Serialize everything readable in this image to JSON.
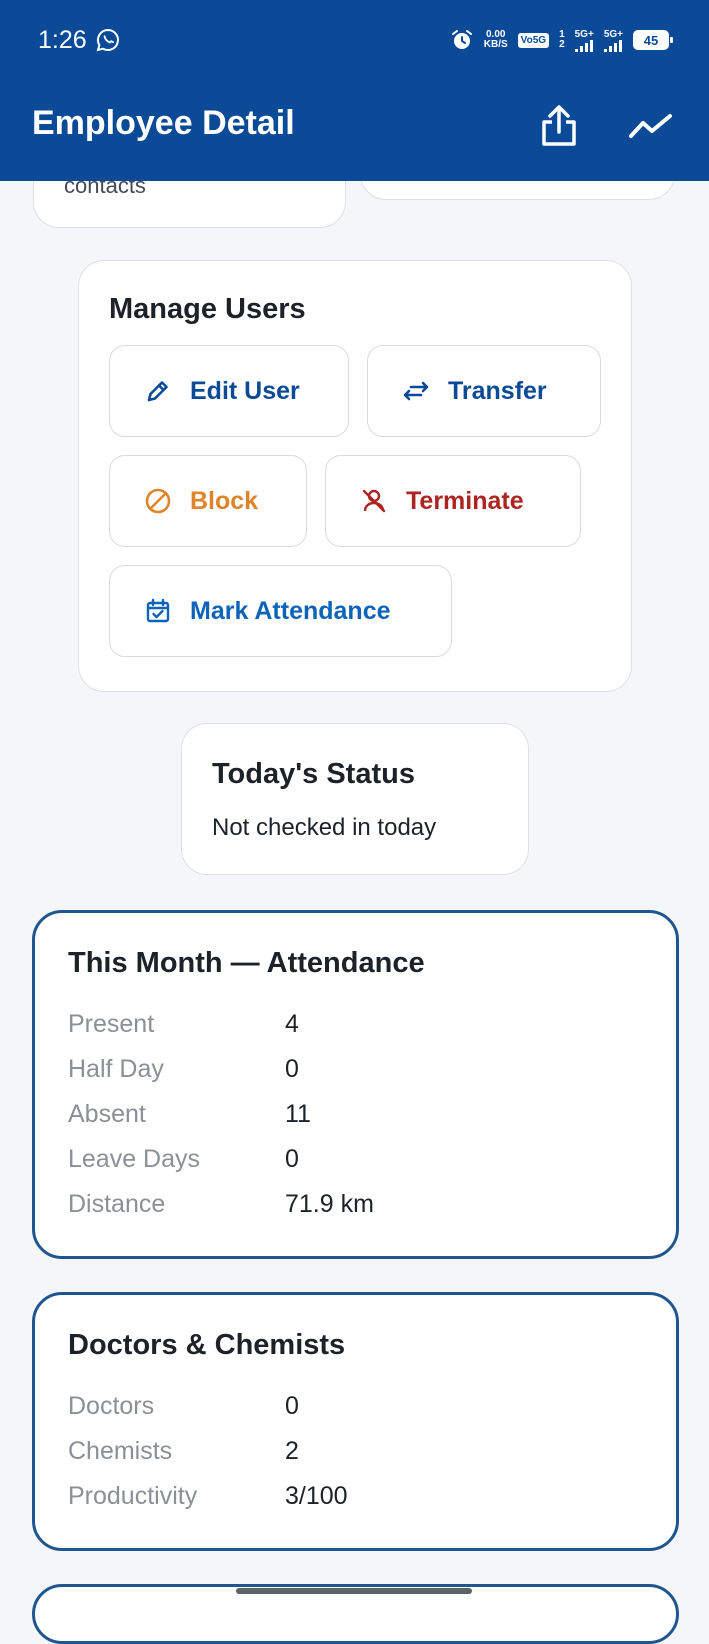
{
  "status_bar": {
    "time": "1:26",
    "net_speed_value": "0.00",
    "net_speed_unit": "KB/S",
    "volte": "Vo5G",
    "sim_1": "1",
    "sim_2": "2",
    "signal_1": "5G+",
    "signal_2": "5G+",
    "battery": "45"
  },
  "app_bar": {
    "title": "Employee Detail",
    "share_icon": "share-icon",
    "trend_icon": "trending-icon"
  },
  "previous_cards": {
    "left_text": "contacts"
  },
  "manage_users": {
    "title": "Manage Users",
    "edit_user": "Edit User",
    "transfer": "Transfer",
    "block": "Block",
    "terminate": "Terminate",
    "mark_attendance": "Mark Attendance"
  },
  "todays_status": {
    "title": "Today's Status",
    "message": "Not checked in today"
  },
  "attendance": {
    "title": "This Month — Attendance",
    "rows": [
      {
        "label": "Present",
        "value": "4"
      },
      {
        "label": "Half Day",
        "value": "0"
      },
      {
        "label": "Absent",
        "value": "11"
      },
      {
        "label": "Leave Days",
        "value": "0"
      },
      {
        "label": "Distance",
        "value": "71.9 km"
      }
    ]
  },
  "doctors_chemists": {
    "title": "Doctors & Chemists",
    "rows": [
      {
        "label": "Doctors",
        "value": "0"
      },
      {
        "label": "Chemists",
        "value": "2"
      },
      {
        "label": "Productivity",
        "value": "3/100"
      }
    ]
  },
  "colors": {
    "app_bar": "#0a4a96",
    "primary_text": "#0a4a96",
    "warning": "#e0842a",
    "danger": "#ad2420",
    "card_border": "#20568f"
  }
}
